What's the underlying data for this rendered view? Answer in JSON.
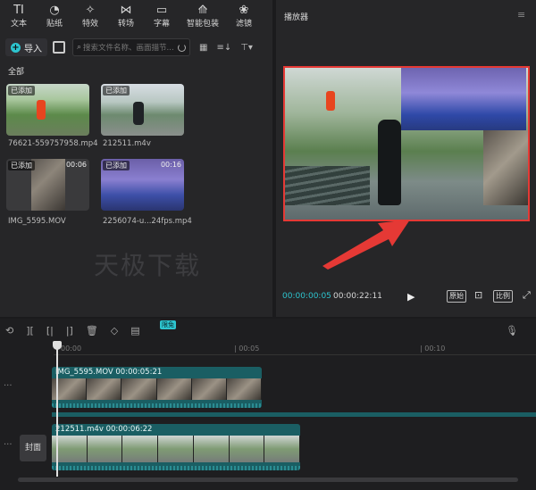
{
  "toolbar": {
    "items": [
      {
        "label": "文本",
        "icon": "text-icon",
        "glyph": "TI"
      },
      {
        "label": "贴纸",
        "icon": "sticker-icon",
        "glyph": "◔"
      },
      {
        "label": "特效",
        "icon": "effects-icon",
        "glyph": "✧"
      },
      {
        "label": "转场",
        "icon": "transition-icon",
        "glyph": "⋈"
      },
      {
        "label": "字幕",
        "icon": "subtitle-icon",
        "glyph": "▭"
      },
      {
        "label": "智能包装",
        "icon": "smart-package-icon",
        "glyph": "⟰"
      },
      {
        "label": "滤镜",
        "icon": "filter-icon",
        "glyph": "❀"
      }
    ],
    "more": "≫"
  },
  "media": {
    "import_label": "导入",
    "search_placeholder": "搜索文件名称、画面描节...",
    "sort_glyph": "≡↓",
    "filter_glyph": "⊤▾",
    "all_label": "全部",
    "added_badge": "已添加",
    "files": [
      {
        "name": "76621-559757958.mp4",
        "duration": ""
      },
      {
        "name": "212511.m4v",
        "duration": ""
      },
      {
        "name": "IMG_5595.MOV",
        "duration": "00:06"
      },
      {
        "name": "2256074-u...24fps.mp4",
        "duration": "00:16"
      }
    ],
    "watermark": "天极下载"
  },
  "player": {
    "title": "播放器",
    "current_time": "00:00:00:05",
    "total_time": "00:00:22:11",
    "buttons": [
      "原始",
      "⊡",
      "比例",
      "⤢"
    ]
  },
  "timeline": {
    "free_badge": "限免",
    "ticks": [
      "00:00",
      "| 00:05",
      "| 00:10"
    ],
    "clips": [
      {
        "label": "IMG_5595.MOV  00:00:05:21"
      },
      {
        "label": "212511.m4v  00:00:06:22"
      }
    ],
    "cover_label": "封面"
  }
}
